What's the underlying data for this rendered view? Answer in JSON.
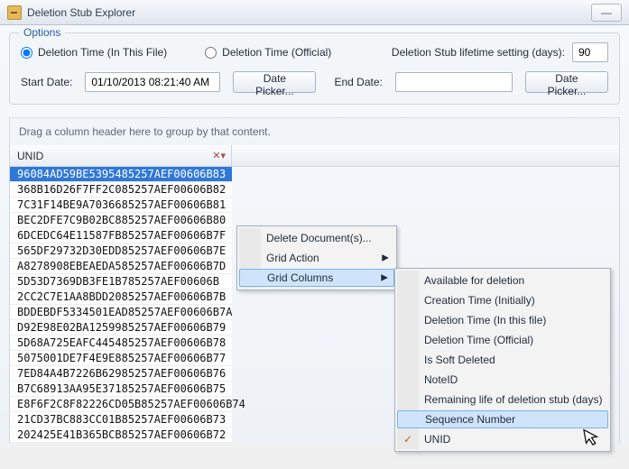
{
  "window": {
    "title": "Deletion Stub Explorer"
  },
  "options": {
    "group_label": "Options",
    "radio_in_file": "Deletion Time (In This File)",
    "radio_official": "Deletion Time (Official)",
    "radio_selected": "in_file",
    "lifetime_label": "Deletion Stub lifetime setting (days):",
    "lifetime_value": "90",
    "start_label": "Start Date:",
    "start_value": "01/10/2013 08:21:40 AM",
    "date_picker_btn": "Date Picker...",
    "end_label": "End Date:",
    "end_value": ""
  },
  "grid": {
    "group_hint": "Drag a column header here to group by that content.",
    "column_header": "UNID",
    "rows": [
      "96084AD59BE5395485257AEF00606B83",
      "368B16D26F7FF2C085257AEF00606B82",
      "7C31F14BE9A7036685257AEF00606B81",
      "BEC2DFE7C9B02BC885257AEF00606B80",
      "6DCEDC64E11587FB85257AEF00606B7F",
      "565DF29732D30EDD85257AEF00606B7E",
      "A8278908EBEAEDA585257AEF00606B7D",
      "5D53D7369DB3FE1B785257AEF00606B",
      "2CC2C7E1AA8BDD2085257AEF00606B7B",
      "BDDEBDF5334501EAD85257AEF00606B7A",
      "D92E98E02BA1259985257AEF00606B79",
      "5D68A725EAFC445485257AEF00606B78",
      "5075001DE7F4E9E885257AEF00606B77",
      "7ED84A4B7226B62985257AEF00606B76",
      "B7C68913AA95E37185257AEF00606B75",
      "E8F6F2C8F82226CD05B85257AEF00606B74",
      "21CD37BC883CC01B85257AEF00606B73",
      "202425E41B365BCB85257AEF00606B72"
    ],
    "selected_index": 0
  },
  "context_menu": {
    "items": [
      {
        "label": "Delete Document(s)...",
        "submenu": false
      },
      {
        "label": "Grid Action",
        "submenu": true
      },
      {
        "label": "Grid Columns",
        "submenu": true,
        "hover": true
      }
    ]
  },
  "columns_submenu": {
    "items": [
      {
        "label": "Available for deletion"
      },
      {
        "label": "Creation Time (Initially)"
      },
      {
        "label": "Deletion Time (In this file)"
      },
      {
        "label": "Deletion Time (Official)"
      },
      {
        "label": "Is Soft Deleted"
      },
      {
        "label": "NoteID"
      },
      {
        "label": "Remaining life of deletion stub (days)"
      },
      {
        "label": "Sequence Number",
        "hover": true
      },
      {
        "label": "UNID",
        "checked": true
      }
    ]
  }
}
